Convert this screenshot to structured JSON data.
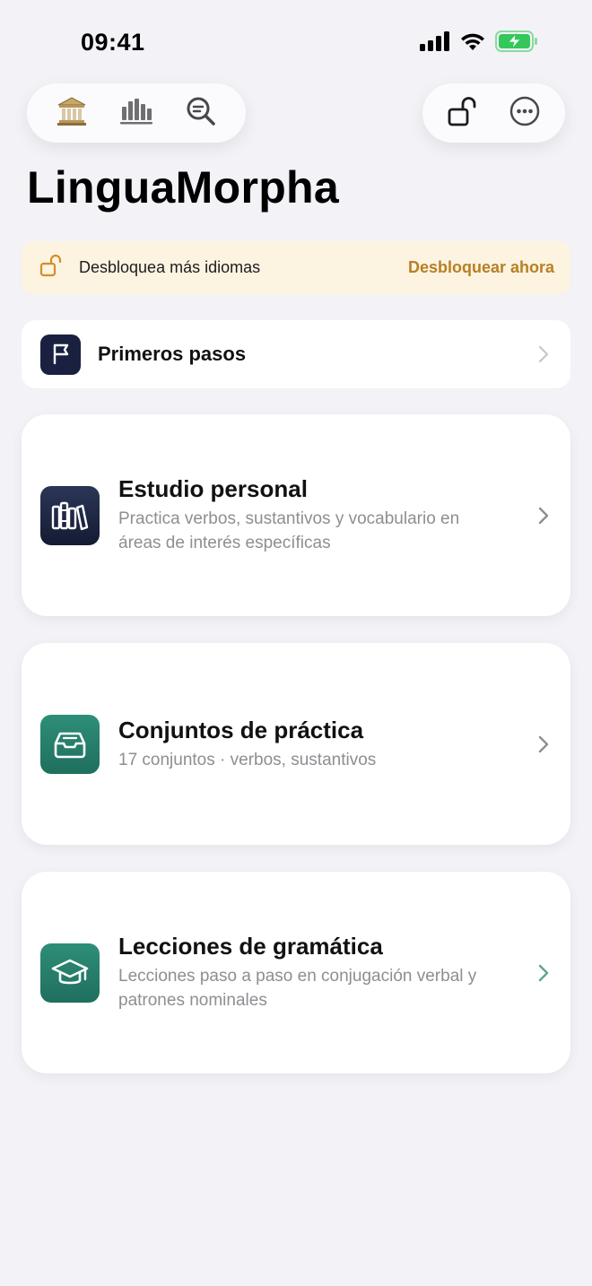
{
  "status_bar": {
    "time": "09:41",
    "icons": [
      "signal-icon",
      "wifi-icon",
      "battery-charging-icon"
    ]
  },
  "toolbar_left": {
    "icons": [
      "museum-icon",
      "chart-bars-icon",
      "search-icon"
    ]
  },
  "toolbar_right": {
    "icons": [
      "unlock-icon",
      "more-icon"
    ]
  },
  "app_title": "LinguaMorpha",
  "unlock_banner": {
    "text": "Desbloquea más idiomas",
    "action": "Desbloquear ahora",
    "accent_color": "#b87f24",
    "background_color": "#fdf3e1"
  },
  "getting_started": {
    "label": "Primeros pasos",
    "icon": "flag-icon"
  },
  "cards": [
    {
      "title": "Estudio personal",
      "subtitle": "Practica verbos, sustantivos y vocabulario en áreas de interés específicas",
      "icon": "books-icon",
      "icon_color": "#1f2747"
    },
    {
      "title": "Conjuntos de práctica",
      "subtitle": "17 conjuntos · verbos, sustantivos",
      "icon": "tray-icon",
      "icon_color": "#27806b"
    },
    {
      "title": "Lecciones de gramática",
      "subtitle": "Lecciones paso a paso en conjugación verbal y patrones nominales",
      "icon": "graduation-cap-icon",
      "icon_color": "#27806b"
    }
  ],
  "colors": {
    "background": "#f2f2f7",
    "card": "#ffffff",
    "subtitle_text": "#8e8e93",
    "battery": "#34c759"
  }
}
